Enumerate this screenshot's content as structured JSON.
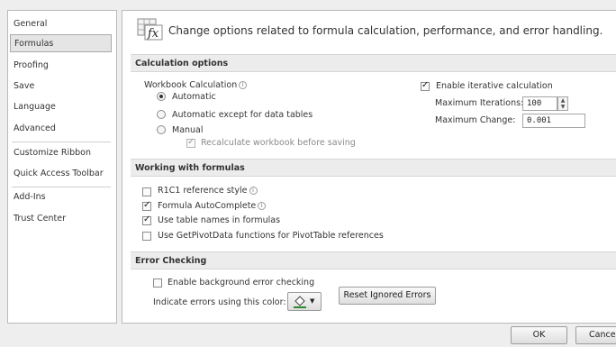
{
  "sidebar": {
    "items": [
      {
        "label": "General"
      },
      {
        "label": "Formulas"
      },
      {
        "label": "Proofing"
      },
      {
        "label": "Save"
      },
      {
        "label": "Language"
      },
      {
        "label": "Advanced"
      },
      {
        "label": "Customize Ribbon"
      },
      {
        "label": "Quick Access Toolbar"
      },
      {
        "label": "Add-Ins"
      },
      {
        "label": "Trust Center"
      }
    ],
    "selected": "Formulas"
  },
  "header": {
    "icon": "fx-formula-icon",
    "text": "Change options related to formula calculation, performance, and error handling."
  },
  "calculation": {
    "title": "Calculation options",
    "workbook_label": "Workbook Calculation",
    "automatic": "Automatic",
    "automatic_except": "Automatic except for data tables",
    "manual": "Manual",
    "recalc": "Recalculate workbook before saving",
    "enable_iterative": "Enable iterative calculation",
    "max_iterations_label": "Maximum Iterations:",
    "max_iterations_value": "100",
    "max_change_label": "Maximum Change:",
    "max_change_value": "0.001"
  },
  "working": {
    "title": "Working with formulas",
    "r1c1": "R1C1 reference style",
    "autocomplete": "Formula AutoComplete",
    "table_names": "Use table names in formulas",
    "getpivot": "Use GetPivotData functions for PivotTable references"
  },
  "errors": {
    "title": "Error Checking",
    "enable_bg": "Enable background error checking",
    "indicate_color": "Indicate errors using this color:",
    "reset_button": "Reset Ignored Errors"
  },
  "footer": {
    "ok": "OK",
    "cancel": "Cancel"
  }
}
